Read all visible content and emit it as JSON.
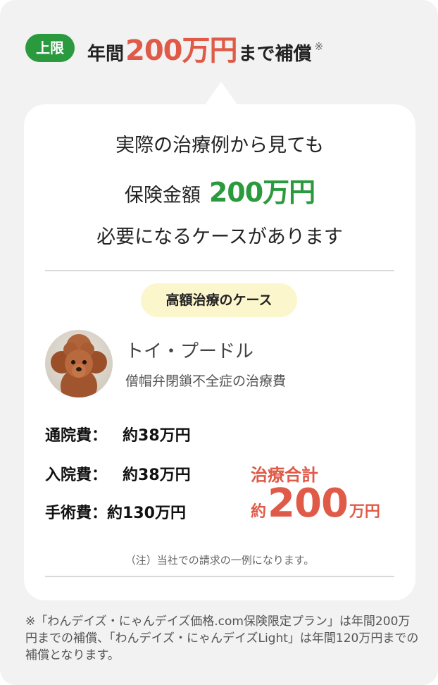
{
  "header": {
    "badge": "上限",
    "prefix": "年間",
    "amount": "200万円",
    "suffix": "まで補償",
    "note_mark": "※"
  },
  "intro": {
    "line1": "実際の治療例から見ても",
    "line2_label": "保険金額",
    "line2_amount": "200万円",
    "line3": "必要になるケースがあります"
  },
  "case": {
    "pill": "高額治療のケース",
    "dog_name": "トイ・プードル",
    "condition": "僧帽弁閉鎖不全症の治療費",
    "costs": [
      {
        "label": "通院費：",
        "value": "約38万円"
      },
      {
        "label": "入院費：",
        "value": "約38万円"
      },
      {
        "label": "手術費：",
        "value": "約130万円"
      }
    ],
    "total_label": "治療合計",
    "total_prefix": "約",
    "total_number": "200",
    "total_unit": "万円",
    "footnote": "（注）当社での請求の一例になります。"
  },
  "disclaimer": "※「わんデイズ・にゃんデイズ価格.com保険限定プラン」は年間200万円までの補償、「わんデイズ・にゃんデイズLight」は年間120万円までの補償となります。",
  "colors": {
    "green": "#2b9a3e",
    "red": "#e05a48",
    "pill": "#fbf6cc",
    "panel": "#f2f2f2"
  }
}
